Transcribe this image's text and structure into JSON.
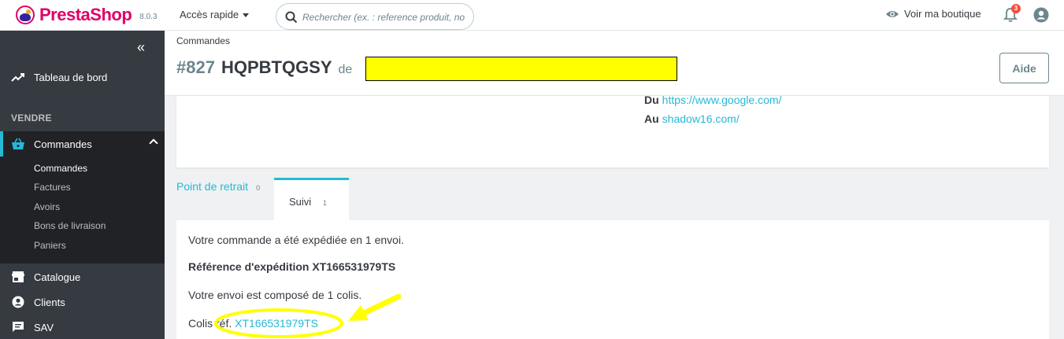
{
  "topbar": {
    "brand": "PrestaShop",
    "version": "8.0.3",
    "quick_access": "Accès rapide",
    "search_placeholder": "Rechercher (ex. : reference produit, no",
    "view_shop": "Voir ma boutique",
    "notifications_count": "3"
  },
  "sidebar": {
    "dashboard": "Tableau de bord",
    "section_sell": "VENDRE",
    "orders": "Commandes",
    "submenu": [
      "Commandes",
      "Factures",
      "Avoirs",
      "Bons de livraison",
      "Paniers"
    ],
    "catalog": "Catalogue",
    "customers": "Clients",
    "sav": "SAV"
  },
  "header": {
    "breadcrumb": "Commandes",
    "order_number": "#827",
    "order_reference": "HQPBTQGSY",
    "from_label": "de",
    "help_button": "Aide"
  },
  "source": {
    "from_label": "Du",
    "from_url": "https://www.google.com/",
    "to_label": "Au",
    "to_url": "shadow16.com/"
  },
  "tabs": {
    "pickup": {
      "label": "Point de retrait",
      "count": "0"
    },
    "tracking": {
      "label": "Suivi",
      "count": "1"
    }
  },
  "tracking": {
    "shipped_text": "Votre commande a été expédiée en 1 envoi.",
    "shipment_reference": "Référence d'expédition XT166531979TS",
    "package_text": "Votre envoi est composé de 1 colis.",
    "parcel_label": "Colis réf.",
    "parcel_link": "XT166531979TS"
  },
  "colors": {
    "accent": "#25b9d7",
    "sidebar": "#363a41",
    "brand": "#df0067",
    "annotation": "#ffff00"
  }
}
